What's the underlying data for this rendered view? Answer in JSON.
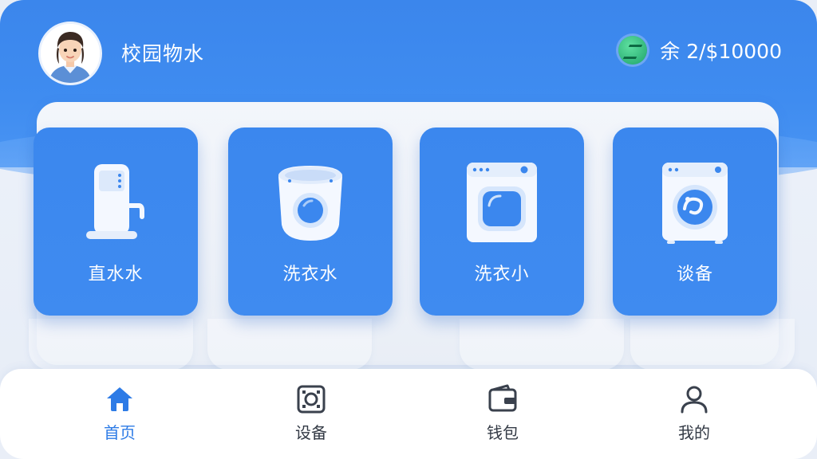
{
  "header": {
    "app_title": "校园物水",
    "balance_text": "余 2/$10000",
    "avatar_icon": "user-avatar",
    "coin_icon": "coin-icon"
  },
  "services": [
    {
      "label": "直水水",
      "icon": "water-dispenser-icon"
    },
    {
      "label": "洗衣水",
      "icon": "top-load-washer-icon"
    },
    {
      "label": "洗衣小",
      "icon": "front-load-washer-icon"
    },
    {
      "label": "谈备",
      "icon": "dryer-icon"
    }
  ],
  "nav": {
    "items": [
      {
        "label": "首页",
        "icon": "home-icon",
        "active": true
      },
      {
        "label": "设备",
        "icon": "device-icon",
        "active": false
      },
      {
        "label": "钱包",
        "icon": "wallet-icon",
        "active": false
      },
      {
        "label": "我的",
        "icon": "profile-icon",
        "active": false
      }
    ]
  },
  "colors": {
    "primary": "#3b87ee",
    "active_nav": "#2d7be6",
    "inactive_nav": "#333a45"
  }
}
